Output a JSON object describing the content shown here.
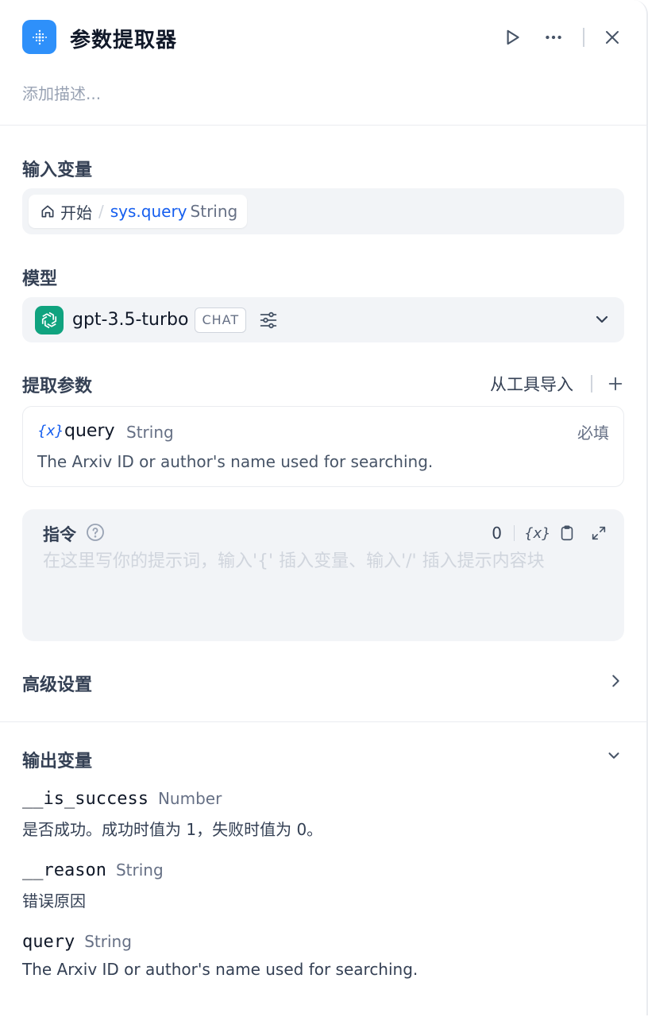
{
  "node": {
    "title": "参数提取器",
    "description_placeholder": "添加描述..."
  },
  "input_vars": {
    "label": "输入变量",
    "source_node": "开始",
    "separator": "/",
    "var_name": "sys.query",
    "var_type": "String"
  },
  "model": {
    "label": "模型",
    "name": "gpt-3.5-turbo",
    "mode": "CHAT"
  },
  "extract_params": {
    "label": "提取参数",
    "import_label": "从工具导入",
    "items": [
      {
        "icon_text": "{x}",
        "name": "query",
        "type": "String",
        "required_label": "必填",
        "description": "The Arxiv ID or author's name used for searching."
      }
    ]
  },
  "instruction": {
    "label": "指令",
    "char_count": "0",
    "var_button": "{x}",
    "placeholder": "在这里写你的提示词，输入'{' 插入变量、输入'/' 插入提示内容块"
  },
  "advanced": {
    "label": "高级设置"
  },
  "outputs": {
    "label": "输出变量",
    "items": [
      {
        "name": "__is_success",
        "type": "Number",
        "description": "是否成功。成功时值为 1，失败时值为 0。"
      },
      {
        "name": "__reason",
        "type": "String",
        "description": "错误原因"
      },
      {
        "name": "query",
        "type": "String",
        "description": "The Arxiv ID or author's name used for searching."
      }
    ]
  },
  "colors": {
    "node_icon_bg": "#2e90fa",
    "openai_bg": "#10a37f",
    "variable_blue": "#155eef",
    "muted_text": "#667085"
  },
  "icons": [
    "node-icon",
    "play-icon",
    "more-icon",
    "close-icon",
    "home-icon",
    "openai-icon",
    "sliders-icon",
    "chevron-down-icon",
    "plus-icon",
    "help-icon",
    "clipboard-icon",
    "expand-icon",
    "chevron-right-icon"
  ]
}
